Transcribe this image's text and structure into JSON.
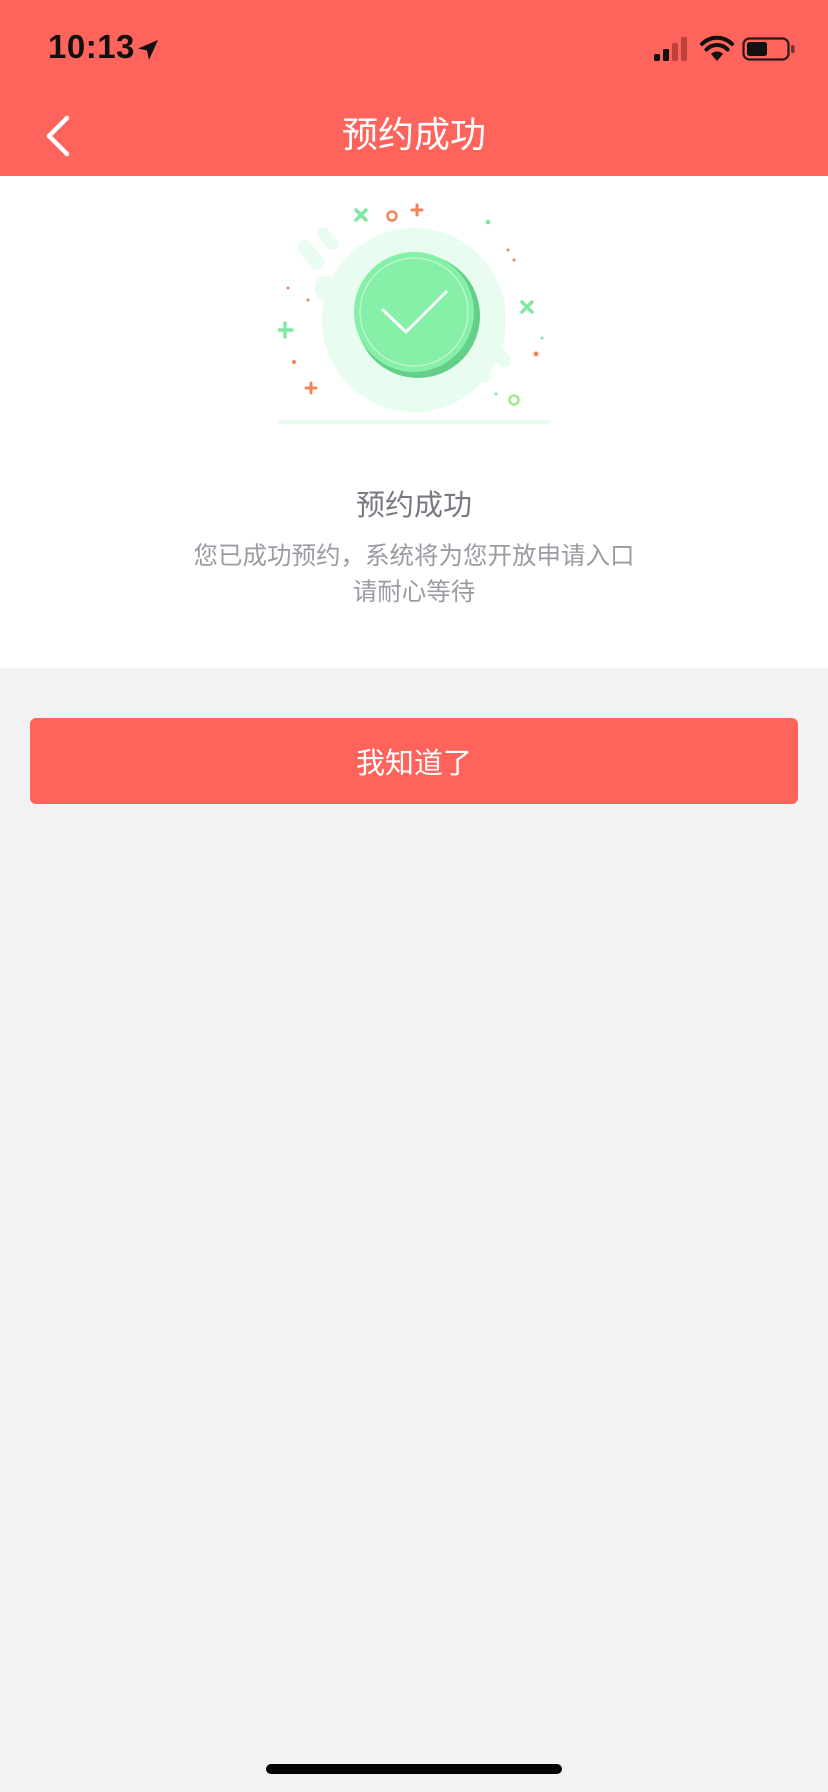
{
  "status_bar": {
    "time": "10:13"
  },
  "nav": {
    "title": "预约成功",
    "back_icon": "chevron-left-icon"
  },
  "result": {
    "icon": "check-circle-icon",
    "title": "预约成功",
    "description_line1": "您已成功预约，系统将为您开放申请入口",
    "description_line2": "请耐心等待"
  },
  "actions": {
    "confirm_label": "我知道了"
  },
  "colors": {
    "brand": "#fe635c",
    "success_green": "#7fe9a4",
    "page_bg": "#f2f2f4"
  }
}
